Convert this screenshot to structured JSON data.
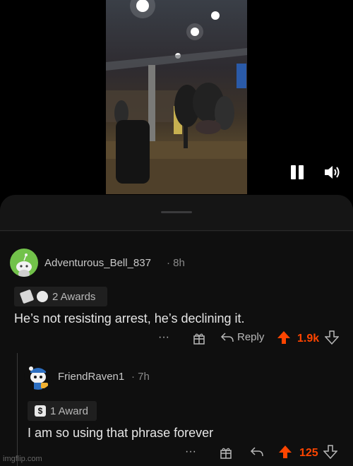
{
  "colors": {
    "upvote": "#ff4500",
    "background": "#0f0f0f",
    "sheet": "#151515"
  },
  "video": {
    "controls": {
      "pause_icon": "pause-icon",
      "volume_icon": "volume-icon"
    }
  },
  "comments": [
    {
      "username": "Adventurous_Bell_837",
      "age": "8h",
      "awards_label": "2 Awards",
      "body": "He’s not resisting arrest, he’s declining it.",
      "more": "···",
      "reply_label": "Reply",
      "score": "1.9k"
    },
    {
      "username": "FriendRaven1",
      "age": "7h",
      "awards_label": "1 Award",
      "body": "I am so using that phrase forever",
      "more": "···",
      "score": "125"
    }
  ],
  "watermark": "imgflip.com"
}
